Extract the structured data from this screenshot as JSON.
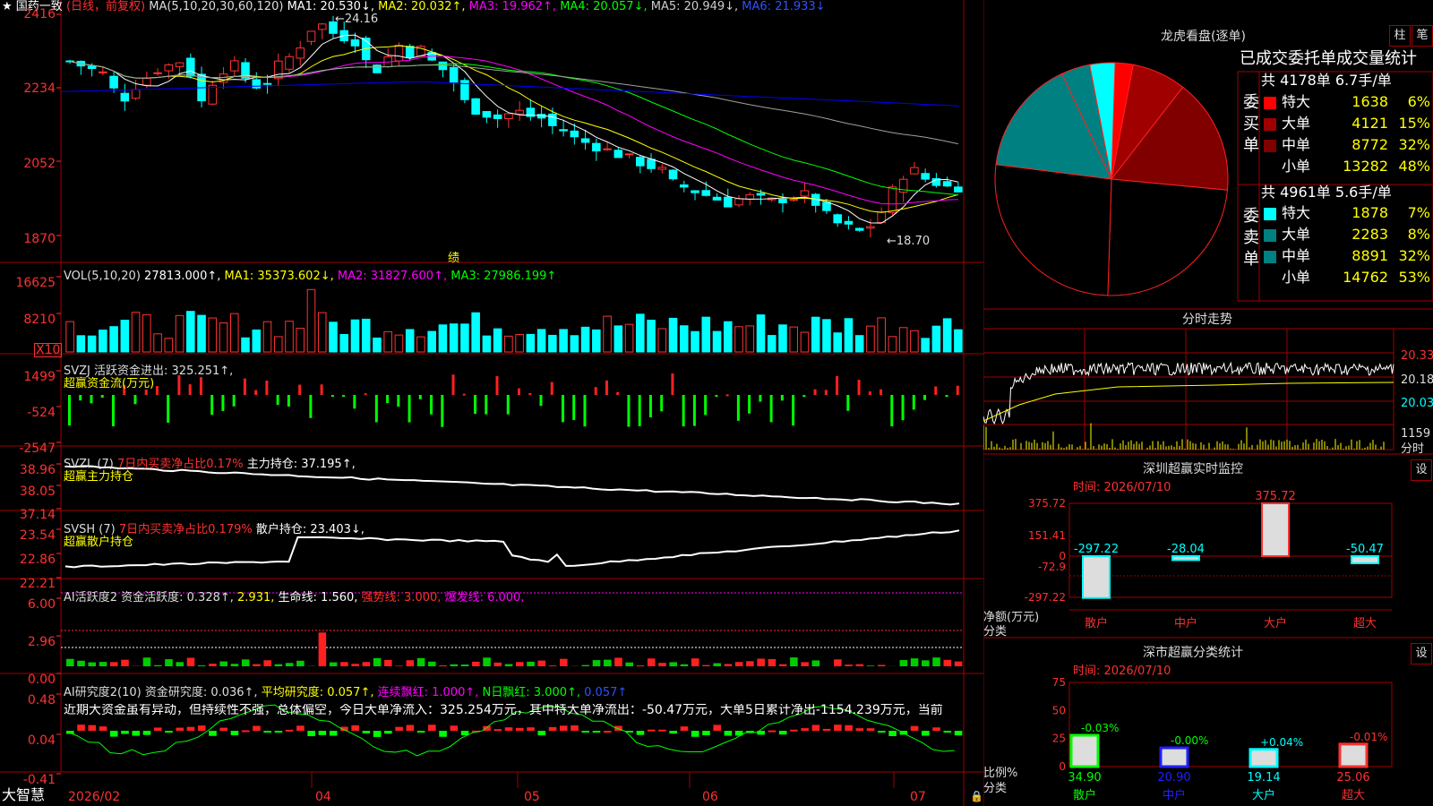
{
  "colors": {
    "up": "#ff3232",
    "down": "#00ffff",
    "grid": "#a00000",
    "ma1": "#ffffff",
    "ma2": "#ffff00",
    "ma3": "#ff00ff",
    "ma4": "#00ff00",
    "ma5": "#a0a0a0",
    "ma6": "#0000ff"
  },
  "main": {
    "star": "★",
    "stock": "国药一致",
    "mode": "(日线，前复权)",
    "ma_title": "MA(5,10,20,30,60,120)",
    "ma1": "MA1: 20.530↓,",
    "ma2": "MA2: 20.032↑,",
    "ma3": "MA3: 19.962↑,",
    "ma4": "MA4: 20.057↓,",
    "ma5": "MA5: 20.949↓,",
    "ma6": "MA6: 21.933↓",
    "high_label": "24.16",
    "low_label": "←18.70",
    "event_label": "绩",
    "y_labels": [
      "2416",
      "2234",
      "2052",
      "1870"
    ],
    "x_labels": [
      "2026/02",
      "04",
      "05",
      "06",
      "07"
    ]
  },
  "vol": {
    "title": "VOL(5,10,20)",
    "value": "27813.000↑,",
    "ma1": "MA1: 35373.602↓,",
    "ma2": "MA2: 31827.600↑,",
    "ma3": "MA3: 27986.199↑",
    "y_labels": [
      "16625",
      "8210"
    ],
    "unit": "X10"
  },
  "svzj": {
    "title": "SVZJ  活跃资金进出: 325.251↑,",
    "subtitle": "超赢资金流(万元)",
    "y_labels": [
      "1499",
      "-524",
      "-2547"
    ]
  },
  "svzl": {
    "title": "SVZL (7)",
    "ratio": "7日内买卖净占比0.17%",
    "hold": "主力持仓: 37.195↑,",
    "subtitle": "超赢主力持仓",
    "y_labels": [
      "38.96",
      "38.05",
      "37.14"
    ]
  },
  "svsh": {
    "title": "SVSH (7)",
    "ratio": "7日内买卖净占比0.179%",
    "hold": "散户持仓: 23.403↓,",
    "subtitle": "超赢散户持仓",
    "y_labels": [
      "23.54",
      "22.86",
      "22.21"
    ]
  },
  "ai1": {
    "title": "AI活跃度2 资金活跃度: 0.328↑,",
    "v2": "2.931,",
    "life": "生命线: 1.560,",
    "strong": "强势线: 3.000,",
    "burst": "爆发线: 6.000,",
    "y_labels": [
      "6.00",
      "2.96",
      "0.00"
    ]
  },
  "ai2": {
    "title": "AI研究度2(10) 资金研究度: 0.036↑,",
    "avg": "平均研究度: 0.057↑,",
    "red": "连续飘红: 1.000↑,",
    "nred": "N日飘红: 3.000↑,",
    "last": "0.057↑",
    "commentary": "近期大资金虽有异动，但持续性不强，总体偏空，今日大单净流入：325.254万元，其中特大单净流出：-50.47万元，大单5日累计净出-1154.239万元，当前",
    "y_labels": [
      "0.48",
      "0.04",
      "-0.41"
    ]
  },
  "bottom": {
    "brand": "大智慧"
  },
  "lhb": {
    "title": "龙虎看盘(逐单)",
    "btn1": "柱",
    "btn2": "笔",
    "header": "已成交委托单成交量统计",
    "buy_label": "委买单",
    "sell_label": "委卖单",
    "buy_total": "共 4178单 6.7手/单",
    "sell_total": "共 4961单 5.6手/单",
    "buy_rows": [
      {
        "name": "特大",
        "vol": "1638",
        "pct": "6%",
        "color": "#ff0000",
        "fraction": 0.06
      },
      {
        "name": "大单",
        "vol": "4121",
        "pct": "15%",
        "color": "#a00000",
        "fraction": 0.15
      },
      {
        "name": "中单",
        "vol": "8772",
        "pct": "32%",
        "color": "#800000",
        "fraction": 0.32
      },
      {
        "name": "小单",
        "vol": "13282",
        "pct": "48%",
        "color": "#000000",
        "fraction": 0.48
      }
    ],
    "sell_rows": [
      {
        "name": "特大",
        "vol": "1878",
        "pct": "7%",
        "color": "#00ffff",
        "fraction": 0.07
      },
      {
        "name": "大单",
        "vol": "2283",
        "pct": "8%",
        "color": "#008080",
        "fraction": 0.08
      },
      {
        "name": "中单",
        "vol": "8891",
        "pct": "32%",
        "color": "#008080",
        "fraction": 0.32
      },
      {
        "name": "小单",
        "vol": "14762",
        "pct": "53%",
        "color": "#000000",
        "fraction": 0.53
      }
    ]
  },
  "intraday": {
    "title": "分时走势",
    "y_labels": [
      "20.33",
      "20.18",
      "20.03"
    ],
    "vol_label": "1159",
    "vol_unit": "分时"
  },
  "sz_monitor": {
    "title": "深圳超赢实时监控",
    "btn": "设",
    "date": "时间: 2026/07/10",
    "y_labels": [
      "375.72",
      "151.41",
      "0",
      "-72.9",
      "-297.22"
    ],
    "ylabel": "净额(万元)",
    "xlabel": "分类",
    "bars": [
      {
        "name": "散户",
        "value": -297.22,
        "label": "-297.22"
      },
      {
        "name": "中户",
        "value": -28.04,
        "label": "-28.04"
      },
      {
        "name": "大户",
        "value": 375.72,
        "label": "375.72"
      },
      {
        "name": "超大",
        "value": -50.47,
        "label": "-50.47"
      }
    ]
  },
  "sc_stats": {
    "title": "深市超赢分类统计",
    "btn": "设",
    "date": "时间: 2026/07/10",
    "y_labels": [
      "75",
      "50",
      "25",
      "0"
    ],
    "ylabel": "比例%",
    "xlabel": "分类",
    "bars": [
      {
        "name": "散户",
        "value": 34.9,
        "label": "34.90",
        "delta": "-0.03%",
        "color": "#00ff00"
      },
      {
        "name": "中户",
        "value": 20.9,
        "label": "20.90",
        "delta": "-0.00%",
        "color": "#2020ff"
      },
      {
        "name": "大户",
        "value": 19.14,
        "label": "19.14",
        "delta": "+0.04%",
        "color": "#00ffff"
      },
      {
        "name": "超大",
        "value": 25.06,
        "label": "25.06",
        "delta": "-0.01%",
        "color": "#ff3030"
      }
    ]
  }
}
